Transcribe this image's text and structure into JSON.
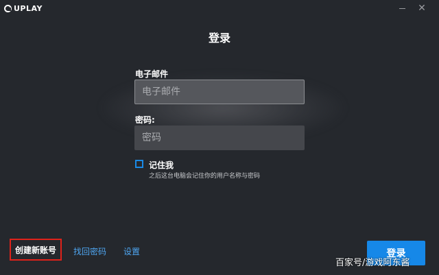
{
  "app": {
    "logo_text": "UPLAY",
    "minimize_icon": "minimize-icon",
    "close_symbol": "✕"
  },
  "login": {
    "title": "登录",
    "email_label": "电子邮件",
    "email_placeholder": "电子邮件",
    "password_label": "密码:",
    "password_placeholder": "密码",
    "remember_label": "记住我",
    "remember_hint": "之后这台电脑会记住你的用户名称与密码",
    "remember_checked": false
  },
  "footer": {
    "create_account": "创建新账号",
    "forgot_password": "找回密码",
    "settings": "设置",
    "login_button": "登录"
  },
  "watermark": "百家号/游戏阿东酱",
  "colors": {
    "background": "#25282d",
    "accent": "#1688e8",
    "link": "#4ea5f0",
    "highlight_border": "#e0221a"
  }
}
